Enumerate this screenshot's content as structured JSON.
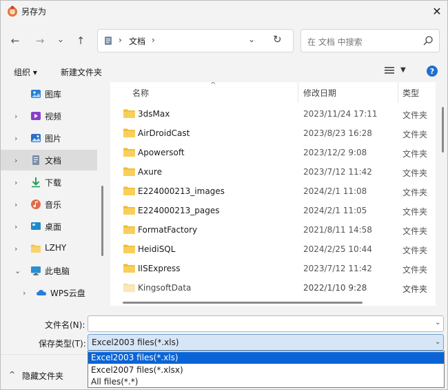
{
  "window": {
    "title": "另存为",
    "close_glyph": "✕"
  },
  "nav": {
    "back_glyph": "←",
    "forward_glyph": "→",
    "recent_glyph": "⌄",
    "up_glyph": "↑"
  },
  "address": {
    "separator": "›",
    "current": "文档",
    "dropdown_glyph": "⌄",
    "refresh_glyph": "↻"
  },
  "search": {
    "placeholder": "在 文档 中搜索"
  },
  "toolbar": {
    "organize": "组织 ▾",
    "new_folder": "新建文件夹",
    "view_dropdown": "▼",
    "help": "?"
  },
  "sidebar": {
    "items": [
      {
        "label": "图库",
        "icon": "gallery-icon",
        "chevron": ""
      },
      {
        "label": "视频",
        "icon": "video-icon",
        "chevron": "›"
      },
      {
        "label": "图片",
        "icon": "pictures-icon",
        "chevron": "›"
      },
      {
        "label": "文档",
        "icon": "documents-icon",
        "chevron": "›"
      },
      {
        "label": "下载",
        "icon": "download-icon",
        "chevron": "›"
      },
      {
        "label": "音乐",
        "icon": "music-icon",
        "chevron": "›"
      },
      {
        "label": "桌面",
        "icon": "desktop-icon",
        "chevron": "›"
      },
      {
        "label": "LZHY",
        "icon": "folder-icon",
        "chevron": "›"
      },
      {
        "label": "此电脑",
        "icon": "computer-icon",
        "chevron": "⌄"
      },
      {
        "label": "WPS云盘",
        "icon": "cloud-icon",
        "chevron": "›"
      }
    ]
  },
  "filelist": {
    "columns": {
      "name": "名称",
      "date": "修改日期",
      "type": "类型"
    },
    "sort_glyph": "^",
    "rows": [
      {
        "name": "3dsMax",
        "date": "2023/11/24 17:11",
        "type": "文件夹"
      },
      {
        "name": "AirDroidCast",
        "date": "2023/8/23 16:28",
        "type": "文件夹"
      },
      {
        "name": "Apowersoft",
        "date": "2023/12/2 9:08",
        "type": "文件夹"
      },
      {
        "name": "Axure",
        "date": "2023/7/12 11:42",
        "type": "文件夹"
      },
      {
        "name": "E224000213_images",
        "date": "2024/2/1 11:08",
        "type": "文件夹"
      },
      {
        "name": "E224000213_pages",
        "date": "2024/2/1 11:05",
        "type": "文件夹"
      },
      {
        "name": "FormatFactory",
        "date": "2021/8/11 14:58",
        "type": "文件夹"
      },
      {
        "name": "HeidiSQL",
        "date": "2024/2/25 10:44",
        "type": "文件夹"
      },
      {
        "name": "IISExpress",
        "date": "2023/7/12 11:42",
        "type": "文件夹"
      },
      {
        "name": "KingsoftData",
        "date": "2022/1/10 9:28",
        "type": "文件夹"
      }
    ]
  },
  "form": {
    "filename_label": "文件名(N):",
    "filename_value": "",
    "filetype_label": "保存类型(T):",
    "filetype_value": "Excel2003 files(*.xls)",
    "dropdown_glyph": "⌄",
    "options": [
      "Excel2003 files(*.xls)",
      "Excel2007 files(*.xlsx)",
      "All files(*.*)"
    ]
  },
  "footer": {
    "chevron": "^",
    "hide_folders": "隐藏文件夹"
  },
  "colors": {
    "accent": "#0a64d6",
    "folder": "#f2c14e",
    "selection": "#d7e6f7"
  }
}
